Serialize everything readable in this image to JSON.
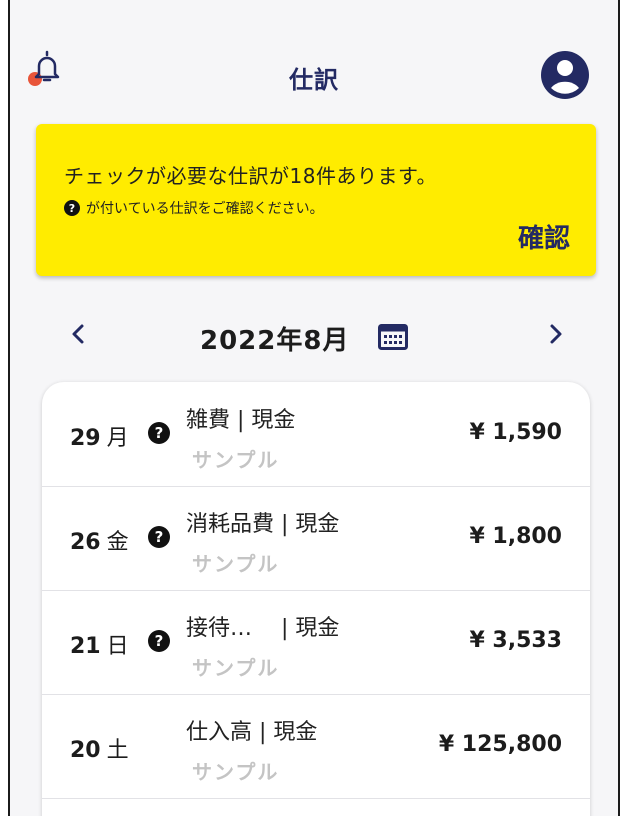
{
  "header": {
    "title": "仕訳",
    "notification_dot_color": "#e8553a",
    "accent_color": "#232a63"
  },
  "banner": {
    "line1": "チェックが必要な仕訳が18件あります。",
    "badge": "?",
    "line2": "が付いている仕訳をご確認ください。",
    "confirm_label": "確認",
    "background": "#ffec00"
  },
  "month_nav": {
    "prev_icon": "chevron-left-icon",
    "label": "2022年8月",
    "calendar_icon": "calendar-icon",
    "next_icon": "chevron-right-icon"
  },
  "entries": [
    {
      "day": "29",
      "dow": "月",
      "flag": "?",
      "title": "雑費 | 現金",
      "sub": "サンプル",
      "amount": "¥ 1,590"
    },
    {
      "day": "26",
      "dow": "金",
      "flag": "?",
      "title": "消耗品費 | 現金",
      "sub": "サンプル",
      "amount": "¥ 1,800"
    },
    {
      "day": "21",
      "dow": "日",
      "flag": "?",
      "title": "接待…　 | 現金",
      "sub": "サンプル",
      "amount": "¥ 3,533"
    },
    {
      "day": "20",
      "dow": "土",
      "flag": "",
      "title": "仕入高 | 現金",
      "sub": "サンプル",
      "amount": "¥ 125,800"
    }
  ]
}
